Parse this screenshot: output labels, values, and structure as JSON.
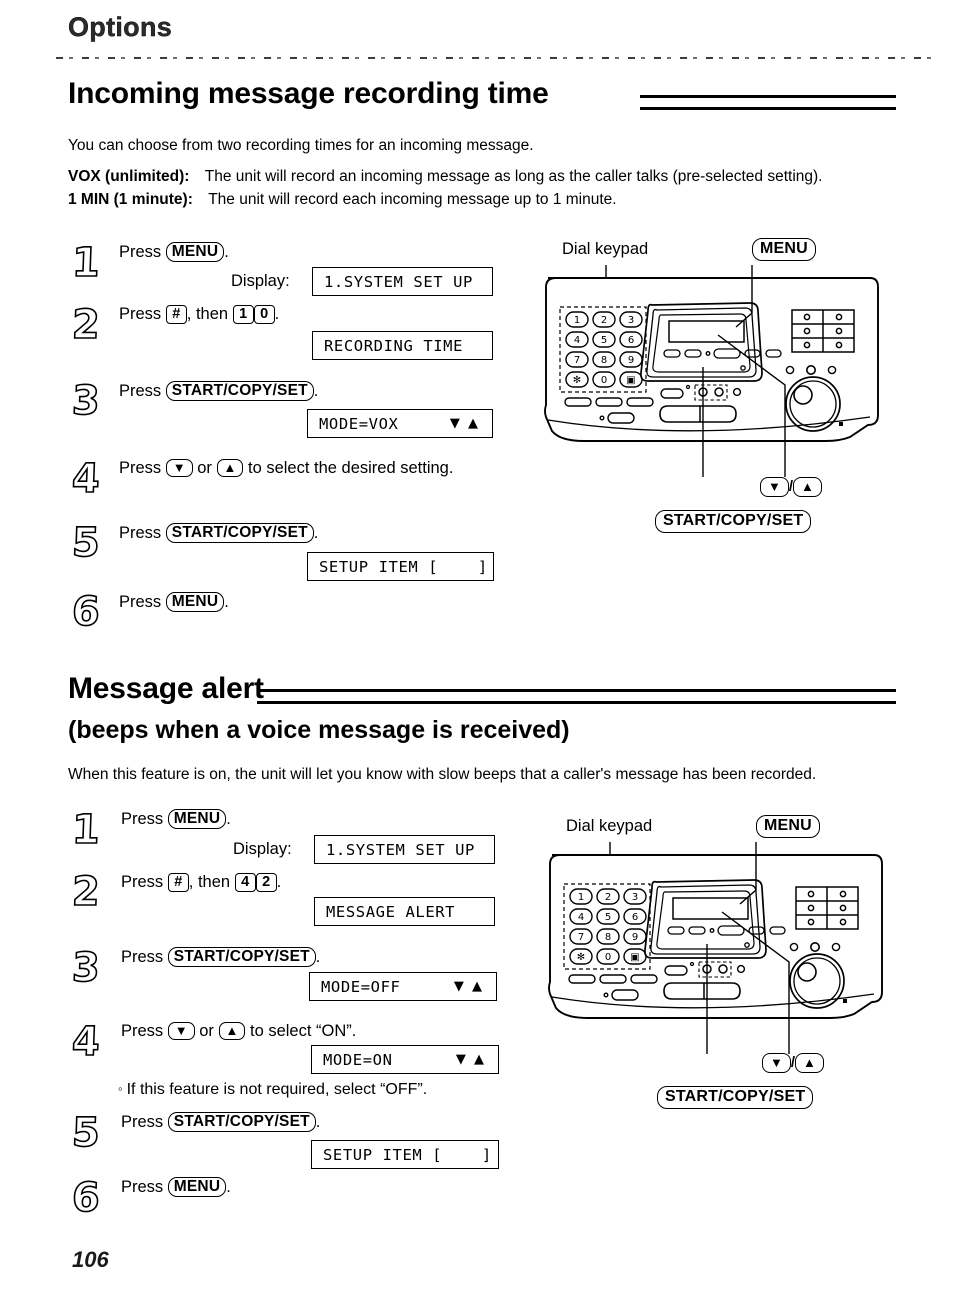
{
  "page": {
    "running_head": "Options",
    "page_number": "106"
  },
  "sections": [
    {
      "id": "incoming-message-recording-time",
      "title": "Incoming message recording time",
      "intro": "You can choose from two recording times for an incoming message.",
      "definitions": [
        {
          "term": "VOX (unlimited):",
          "text": "The unit will record an incoming message as long as the caller talks (pre-selected setting)."
        },
        {
          "term": "1 MIN (1 minute):",
          "text": "The unit will record each incoming message up to 1 minute."
        }
      ],
      "steps": [
        {
          "number": "1",
          "press_label": "Press",
          "key": "MENU",
          "key_type": "capsule",
          "period": ".",
          "display_label": "Display:",
          "display": {
            "text": "1.SYSTEM SET UP",
            "arrows": ""
          }
        },
        {
          "number": "2",
          "press_label": "Press",
          "key": "#",
          "key_type": "square",
          "then_label": ", then",
          "keys": [
            "1",
            "0"
          ],
          "period": ".",
          "display": {
            "text": "RECORDING TIME",
            "arrows": ""
          }
        },
        {
          "number": "3",
          "press_label": "Press",
          "key": "START/COPY/SET",
          "key_type": "capsule",
          "period": ".",
          "display": {
            "text": "MODE=VOX",
            "arrows": "▼ ▲"
          }
        },
        {
          "number": "4",
          "press_label": "Press",
          "key_down": "▼",
          "or_label": "or",
          "key_up": "▲",
          "tail": "to select the desired setting."
        },
        {
          "number": "5",
          "press_label": "Press",
          "key": "START/COPY/SET",
          "key_type": "capsule",
          "period": ".",
          "display": {
            "text": "SETUP ITEM [    ]",
            "arrows": ""
          }
        },
        {
          "number": "6",
          "press_label": "Press",
          "key": "MENU",
          "key_type": "capsule",
          "period": "."
        }
      ]
    },
    {
      "id": "message-alert",
      "title": "Message alert",
      "subtitle": "(beeps when a voice message is received)",
      "intro": "When this feature is on, the unit will let you know with slow beeps that a caller's message has been recorded.",
      "steps": [
        {
          "number": "1",
          "press_label": "Press",
          "key": "MENU",
          "key_type": "capsule",
          "period": ".",
          "display_label": "Display:",
          "display": {
            "text": "1.SYSTEM SET UP",
            "arrows": ""
          }
        },
        {
          "number": "2",
          "press_label": "Press",
          "key": "#",
          "key_type": "square",
          "then_label": ", then",
          "keys": [
            "4",
            "2"
          ],
          "period": ".",
          "display": {
            "text": "MESSAGE ALERT",
            "arrows": ""
          }
        },
        {
          "number": "3",
          "press_label": "Press",
          "key": "START/COPY/SET",
          "key_type": "capsule",
          "period": ".",
          "display": {
            "text": "MODE=OFF",
            "arrows": "▼ ▲"
          }
        },
        {
          "number": "4",
          "press_label": "Press",
          "key_down": "▼",
          "or_label": "or",
          "key_up": "▲",
          "tail": "to select “ON”.",
          "display": {
            "text": "MODE=ON",
            "arrows": "▼ ▲"
          },
          "note": "If this feature is not required, select “OFF”."
        },
        {
          "number": "5",
          "press_label": "Press",
          "key": "START/COPY/SET",
          "key_type": "capsule",
          "period": ".",
          "display": {
            "text": "SETUP ITEM [    ]",
            "arrows": ""
          }
        },
        {
          "number": "6",
          "press_label": "Press",
          "key": "MENU",
          "key_type": "capsule",
          "period": "."
        }
      ]
    }
  ],
  "diagram": {
    "dial_keypad_label": "Dial keypad",
    "menu_callout": "MENU",
    "start_callout": "START/COPY/SET",
    "arrow_down": "▼",
    "arrow_slash": "/",
    "arrow_up": "▲",
    "keypad_keys": [
      "1",
      "2",
      "3",
      "4",
      "5",
      "6",
      "7",
      "8",
      "9",
      "✻",
      "0",
      "▣"
    ]
  }
}
